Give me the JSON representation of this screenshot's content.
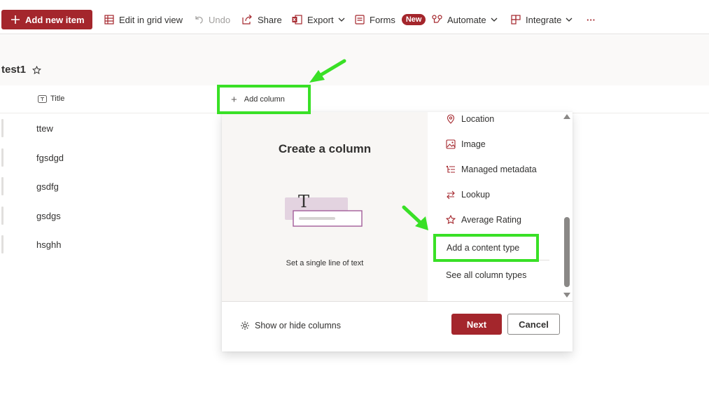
{
  "toolbar": {
    "add_new_item": "Add new item",
    "edit_grid": "Edit in grid view",
    "undo": "Undo",
    "share": "Share",
    "export": "Export",
    "forms": "Forms",
    "forms_badge": "New",
    "automate": "Automate",
    "integrate": "Integrate",
    "more": "···"
  },
  "list": {
    "title": "test1",
    "column_title": "Title",
    "add_column": "Add column",
    "rows": [
      "ttew",
      "fgsdgd",
      "gsdfg",
      "gsdgs",
      "hsghh"
    ]
  },
  "panel": {
    "heading": "Create a column",
    "illustration_caption": "Set a single line of text",
    "types": [
      "Location",
      "Image",
      "Managed metadata",
      "Lookup",
      "Average Rating"
    ],
    "add_content_type": "Add a content type",
    "see_all": "See all column types",
    "show_hide": "Show or hide columns",
    "next": "Next",
    "cancel": "Cancel"
  },
  "colors": {
    "accent": "#a4262c",
    "highlight": "#39e026"
  }
}
